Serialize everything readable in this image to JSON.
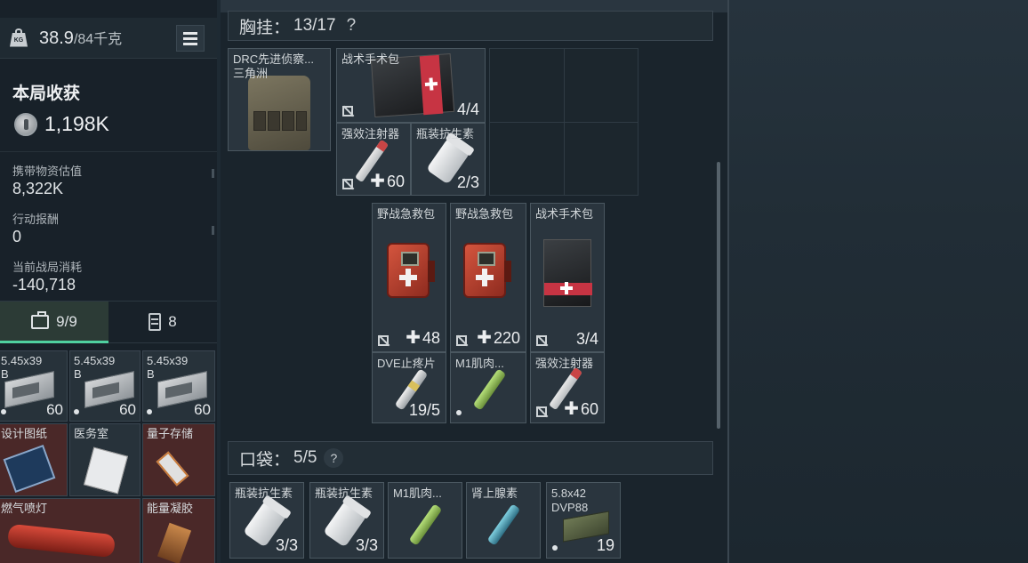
{
  "left_panel": {
    "weight": "38.9",
    "weight_max": "/84千克",
    "weight_icon_label": "KG",
    "harvest_title": "本局收获",
    "harvest_value": "1,198K",
    "stats": [
      {
        "label": "携带物资估值",
        "value": "8,322K"
      },
      {
        "label": "行动报酬",
        "value": "0"
      },
      {
        "label": "当前战局消耗",
        "value": "-140,718"
      }
    ],
    "tabs": [
      {
        "label": "9/9",
        "icon": "briefcase-icon",
        "active": true
      },
      {
        "label": "8",
        "icon": "backpack-icon",
        "active": false
      }
    ],
    "items": [
      {
        "name": "5.45x39",
        "sub": "B",
        "qty": "60"
      },
      {
        "name": "5.45x39",
        "sub": "B",
        "qty": "60"
      },
      {
        "name": "5.45x39",
        "sub": "B",
        "qty": "60"
      },
      {
        "name": "设计图纸",
        "qty": ""
      },
      {
        "name": "医务室",
        "qty": ""
      },
      {
        "name": "量子存储",
        "qty": ""
      },
      {
        "name": "燃气喷灯",
        "qty": ""
      },
      {
        "name": "能量凝胶",
        "qty": ""
      }
    ]
  },
  "chest_rig": {
    "title": "胸挂：",
    "count": "13/17",
    "help": "?",
    "vest_name_line1": "DRC先进侦察...",
    "vest_name_line2": "三角洲",
    "items": [
      {
        "name": "战术手术包",
        "qty": "4/4"
      },
      {
        "name": "强效注射器",
        "qty": "60"
      },
      {
        "name": "瓶装抗生素",
        "qty": "2/3"
      },
      {
        "name": "野战急救包",
        "qty": "48"
      },
      {
        "name": "野战急救包",
        "qty": "220"
      },
      {
        "name": "战术手术包",
        "qty": "3/4"
      },
      {
        "name": "DVE止疼片",
        "qty": "19/5"
      },
      {
        "name": "M1肌肉...",
        "qty": ""
      },
      {
        "name": "强效注射器",
        "qty": "60"
      }
    ]
  },
  "pocket": {
    "title": "口袋：",
    "count": "5/5",
    "help": "?",
    "items": [
      {
        "name": "瓶装抗生素",
        "qty": "3/3"
      },
      {
        "name": "瓶装抗生素",
        "qty": "3/3"
      },
      {
        "name": "M1肌肉...",
        "qty": ""
      },
      {
        "name": "肾上腺素",
        "qty": ""
      },
      {
        "name": "5.8x42",
        "sub": "DVP88",
        "qty": "19"
      }
    ]
  }
}
